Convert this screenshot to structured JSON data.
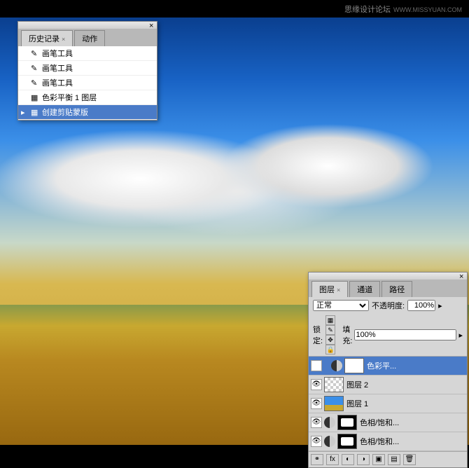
{
  "watermark": {
    "text": "思缘设计论坛",
    "url": "WWW.MISSYUAN.COM"
  },
  "history": {
    "tabs": [
      {
        "label": "历史记录",
        "active": true
      },
      {
        "label": "动作",
        "active": false
      }
    ],
    "items": [
      {
        "label": "画笔工具",
        "icon": "brush"
      },
      {
        "label": "画笔工具",
        "icon": "brush"
      },
      {
        "label": "画笔工具",
        "icon": "brush"
      },
      {
        "label": "色彩平衡 1 图层",
        "icon": "layer"
      },
      {
        "label": "创建剪贴蒙版",
        "icon": "layer",
        "selected": true
      }
    ]
  },
  "layers": {
    "tabs": [
      {
        "label": "图层",
        "active": true
      },
      {
        "label": "通道",
        "active": false
      },
      {
        "label": "路径",
        "active": false
      }
    ],
    "blend_mode": "正常",
    "opacity_label": "不透明度:",
    "opacity_value": "100%",
    "lock_label": "锁定:",
    "fill_label": "填充:",
    "fill_value": "100%",
    "items": [
      {
        "name": "色彩平...",
        "type": "adjustment",
        "selected": true,
        "mask": "white"
      },
      {
        "name": "图层 2",
        "type": "layer",
        "thumb": "trans"
      },
      {
        "name": "图层 1",
        "type": "layer",
        "thumb": "image"
      },
      {
        "name": "色相/饱和...",
        "type": "adjustment",
        "mask": "pattern"
      },
      {
        "name": "色相/饱和...",
        "type": "adjustment",
        "mask": "pattern"
      }
    ]
  }
}
